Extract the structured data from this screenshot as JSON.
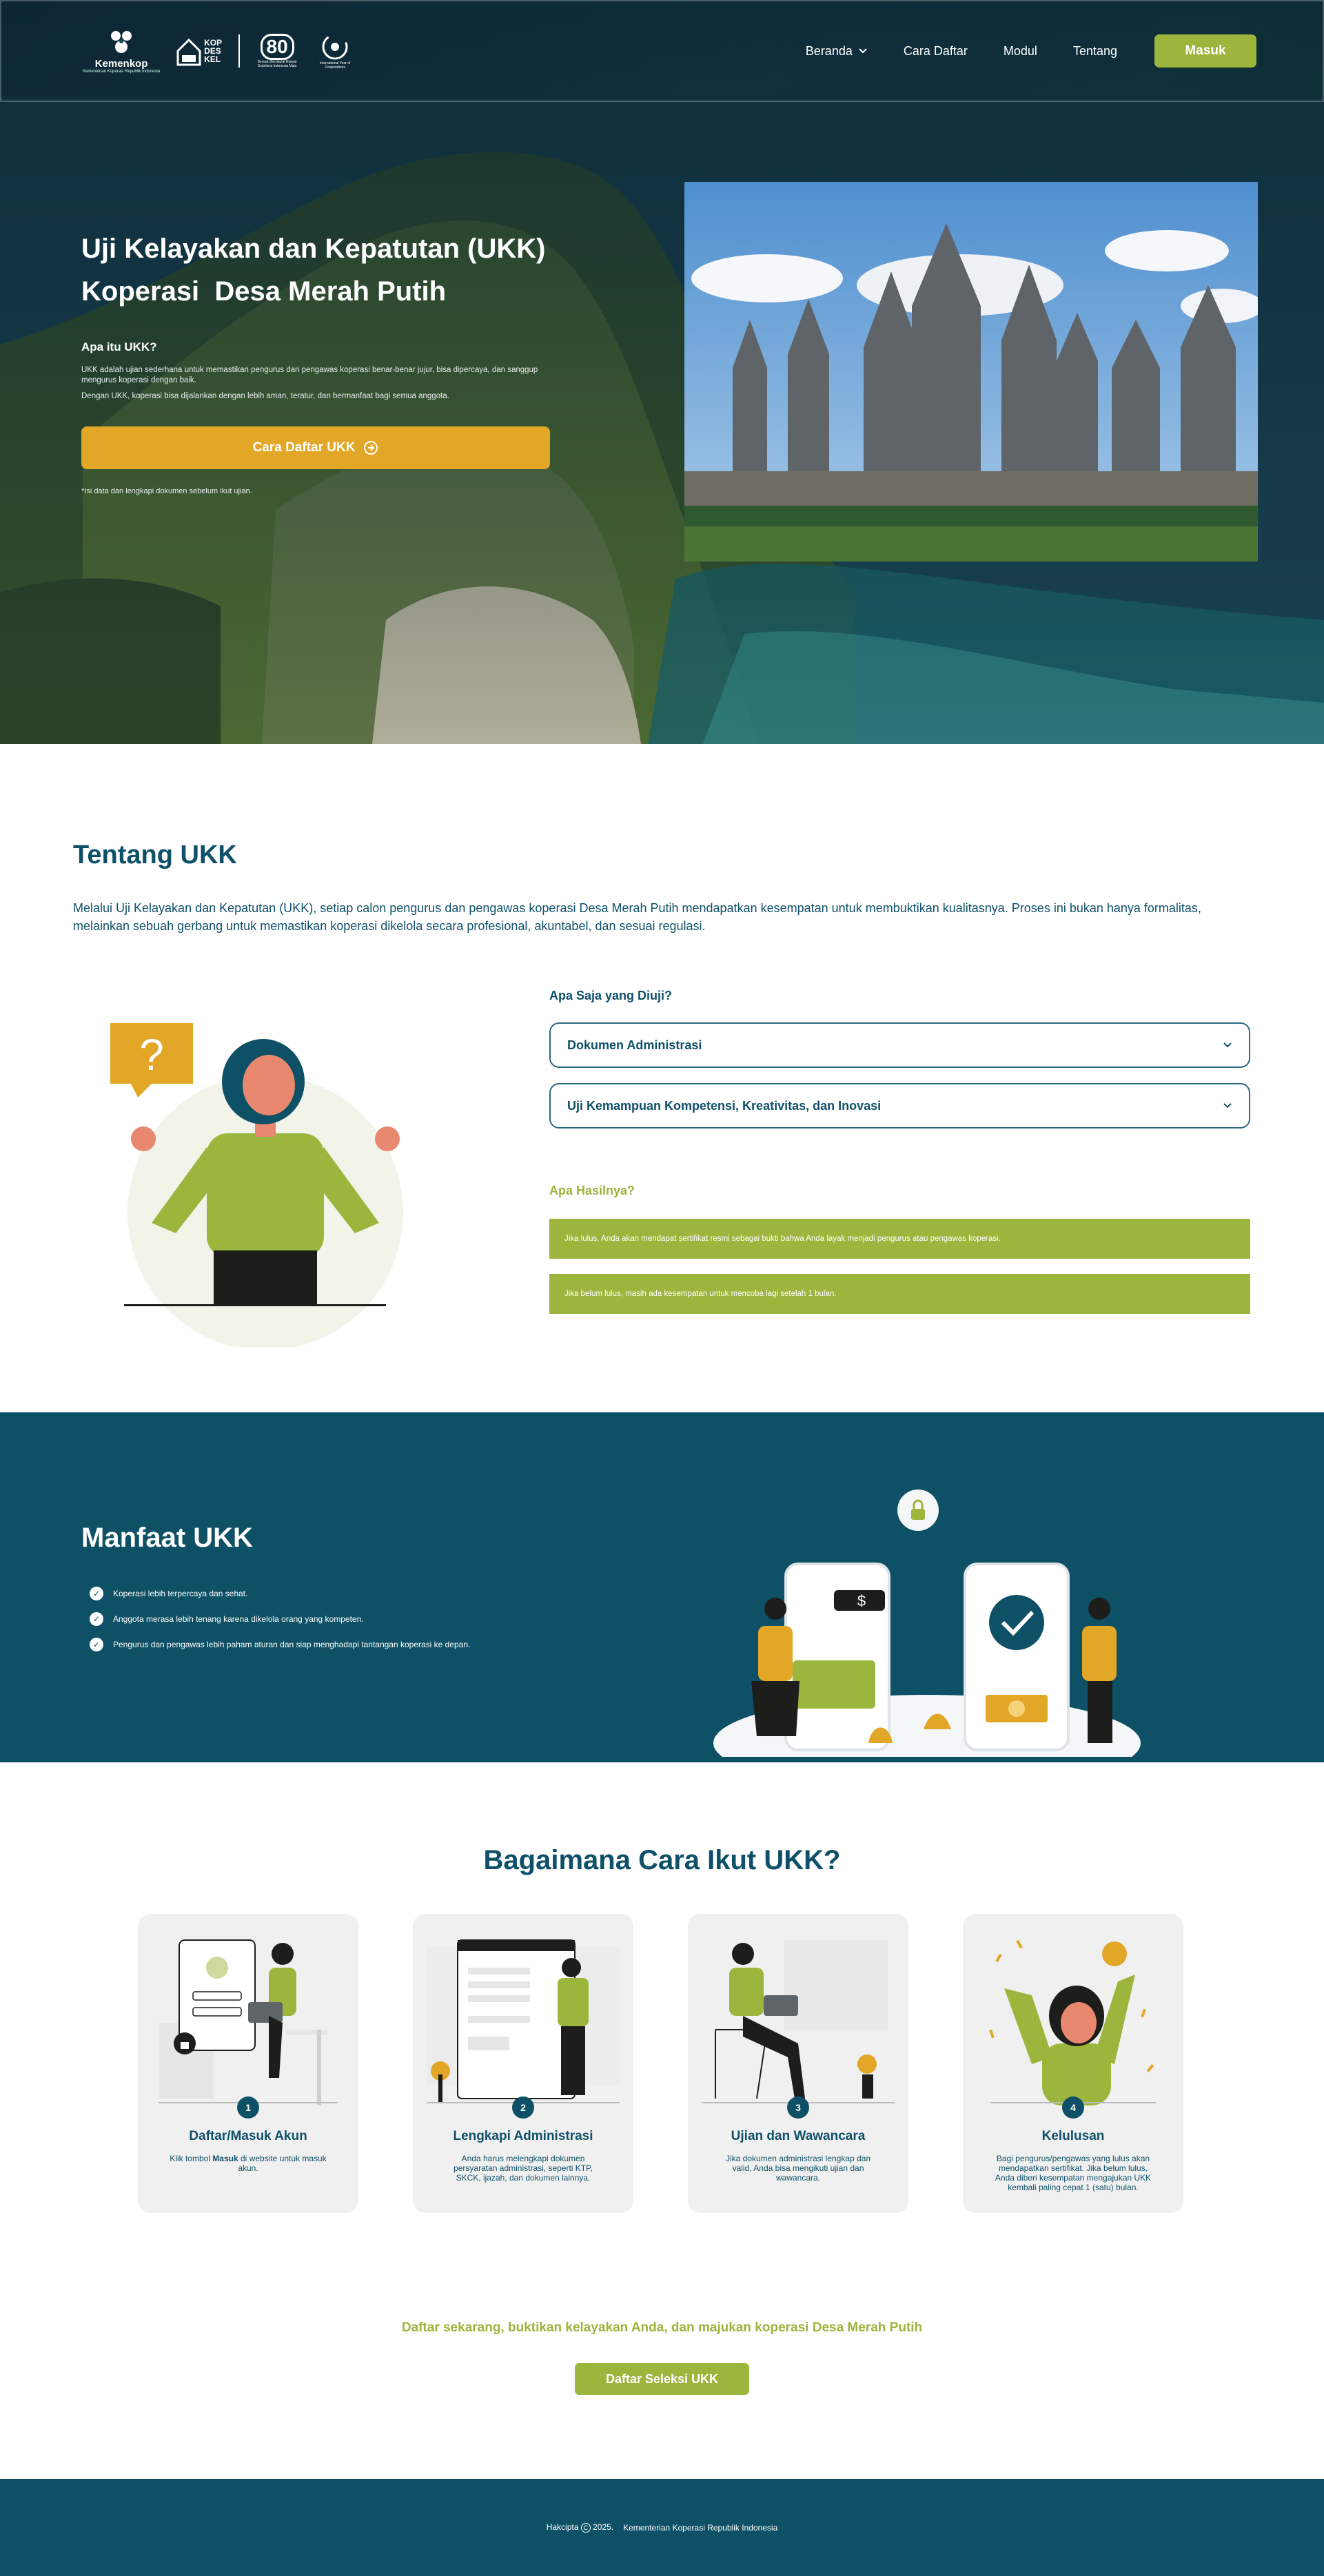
{
  "colors": {
    "primary": "#0e5065",
    "accent_green": "#9cb53c",
    "accent_yellow": "#e2a727",
    "white": "#ffffff"
  },
  "header": {
    "logo_kemenkop": "Kemenkop",
    "logo_kemenkop_sub": "Kementerian Koperasi Republik Indonesia",
    "logo_kop": [
      "KOP",
      "DES",
      "KEL"
    ],
    "logo_80": "80",
    "logo_80_sub": "Bersatu Berdaulat Rakyat Sejahtera Indonesia Maju",
    "logo_iyc_sub": "International Year of Cooperatives",
    "nav": {
      "beranda": "Beranda",
      "cara_daftar": "Cara Daftar",
      "modul": "Modul",
      "tentang": "Tentang"
    },
    "login_button": "Masuk"
  },
  "hero": {
    "title_line1": "Uji Kelayakan dan Kepatutan (UKK)",
    "title_line2": "Koperasi  Desa Merah Putih",
    "question": "Apa itu UKK?",
    "paragraph1": "UKK adalah ujian sederhana untuk memastikan pengurus dan pengawas koperasi benar-benar jujur, bisa dipercaya, dan sanggup mengurus koperasi dengan baik.",
    "paragraph2": "Dengan UKK, koperasi bisa dijalankan dengan lebih aman, teratur, dan bermanfaat bagi semua anggota.",
    "cta_button": "Cara Daftar UKK",
    "note": "*Isi data dan lengkapi dokumen sebelum ikut ujian."
  },
  "tentang": {
    "title": "Tentang UKK",
    "description": "Melalui Uji Kelayakan dan Kepatutan (UKK), setiap calon pengurus dan pengawas koperasi Desa Merah Putih mendapatkan kesempatan untuk membuktikan kualitasnya. Proses ini bukan hanya formalitas, melainkan sebuah gerbang untuk memastikan koperasi dikelola secara profesional, akuntabel, dan sesuai regulasi.",
    "diuji_heading": "Apa Saja yang Diuji?",
    "accordion": [
      {
        "label": "Dokumen Administrasi"
      },
      {
        "label": "Uji Kemampuan Kompetensi, Kreativitas, dan Inovasi"
      }
    ],
    "hasil_heading": "Apa Hasilnya?",
    "hasil": [
      "Jika lulus, Anda akan mendapat sertifikat resmi sebagai bukti bahwa Anda layak menjadi pengurus atau pengawas koperasi.",
      "Jika belum lulus, masih ada kesempatan untuk mencoba lagi setelah 1 bulan."
    ],
    "question_mark": "?"
  },
  "manfaat": {
    "title": "Manfaat UKK",
    "items": [
      "Koperasi lebih terpercaya dan sehat.",
      "Anggota merasa lebih tenang karena dikelola orang yang kompeten.",
      "Pengurus dan pengawas lebih paham aturan dan siap menghadapi tantangan koperasi ke depan."
    ]
  },
  "cara": {
    "title": "Bagaimana Cara Ikut UKK?",
    "steps": [
      {
        "num": "1",
        "title": "Daftar/Masuk Akun",
        "desc_pre": "Klik tombol ",
        "desc_bold": "Masuk",
        "desc_post": " di website untuk masuk akun."
      },
      {
        "num": "2",
        "title": "Lengkapi Administrasi",
        "desc": "Anda harus melengkapi dokumen persyaratan administrasi, seperti KTP, SKCK, ijazah, dan dokumen lainnya."
      },
      {
        "num": "3",
        "title": "Ujian dan Wawancara",
        "desc": "Jika dokumen administrasi lengkap dan valid, Anda bisa mengikuti ujian dan wawancara."
      },
      {
        "num": "4",
        "title": "Kelulusan",
        "desc": "Bagi pengurus/pengawas yang lulus akan mendapatkan sertifikat. Jika belum lulus, Anda diberi kesempatan mengajukan UKK kembali paling cepat 1 (satu) bulan."
      }
    ],
    "cta_text": "Daftar sekarang, buktikan kelayakan Anda, dan majukan koperasi Desa Merah Putih",
    "cta_button": "Daftar Seleksi UKK"
  },
  "footer": {
    "prefix": "Hakcipta",
    "year": "2025.",
    "owner": "Kementerian Koperasi Republik Indonesia"
  }
}
